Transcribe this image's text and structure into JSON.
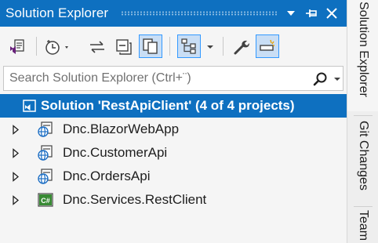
{
  "window": {
    "title": "Solution Explorer",
    "icons": {
      "dropdown": "window-position-dropdown-icon",
      "pin": "auto-hide-pin-icon",
      "close": "close-icon"
    }
  },
  "toolbar": {
    "tools": [
      {
        "name": "vs-solution-switch-views-icon"
      },
      {
        "name": "pending-changes-filter-clock-icon"
      },
      {
        "name": "sync-with-active-document-icon"
      },
      {
        "name": "collapse-all-icon"
      },
      {
        "name": "show-all-files-icon",
        "selected": true
      },
      {
        "name": "track-active-item-icon",
        "selected": true
      },
      {
        "name": "properties-wrench-icon"
      },
      {
        "name": "preview-selected-items-icon",
        "selected": true
      }
    ]
  },
  "search": {
    "placeholder": "Search Solution Explorer (Ctrl+¨)"
  },
  "tree": {
    "solution": {
      "label": "Solution 'RestApiClient' (4 of 4 projects)",
      "icon": "solution-icon"
    },
    "projects": [
      {
        "label": "Dnc.BlazorWebApp",
        "icon": "web-project-icon"
      },
      {
        "label": "Dnc.CustomerApi",
        "icon": "web-project-icon"
      },
      {
        "label": "Dnc.OrdersApi",
        "icon": "web-project-icon"
      },
      {
        "label": "Dnc.Services.RestClient",
        "icon": "csharp-project-icon"
      }
    ]
  },
  "side_tabs": [
    {
      "label": "Solution Explorer",
      "active": true
    },
    {
      "label": "Git Changes"
    },
    {
      "label": "Team"
    }
  ],
  "colors": {
    "accent": "#0e70c0",
    "selected_tool_bg": "#c9def5",
    "selected_tool_border": "#3399ff"
  }
}
